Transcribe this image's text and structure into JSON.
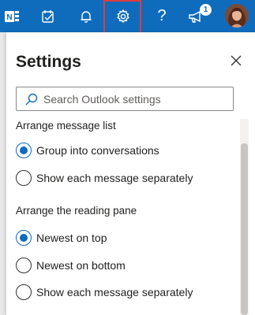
{
  "topbar": {
    "background": "#0f6cbd",
    "icons": [
      "onenote-icon",
      "todo-icon",
      "bell-icon",
      "gear-icon",
      "help-icon",
      "megaphone-icon"
    ],
    "help_label": "?",
    "notification_count": "1",
    "highlight_color": "#e03c3c"
  },
  "settings": {
    "title": "Settings",
    "search_placeholder": "Search Outlook settings",
    "sections": [
      {
        "heading": "Arrange message list",
        "options": [
          {
            "label": "Group into conversations",
            "checked": true
          },
          {
            "label": "Show each message separately",
            "checked": false
          }
        ]
      },
      {
        "heading": "Arrange the reading pane",
        "options": [
          {
            "label": "Newest on top",
            "checked": true
          },
          {
            "label": "Newest on bottom",
            "checked": false
          },
          {
            "label": "Show each message separately",
            "checked": false
          }
        ]
      }
    ],
    "accent": "#0f6cbd"
  }
}
